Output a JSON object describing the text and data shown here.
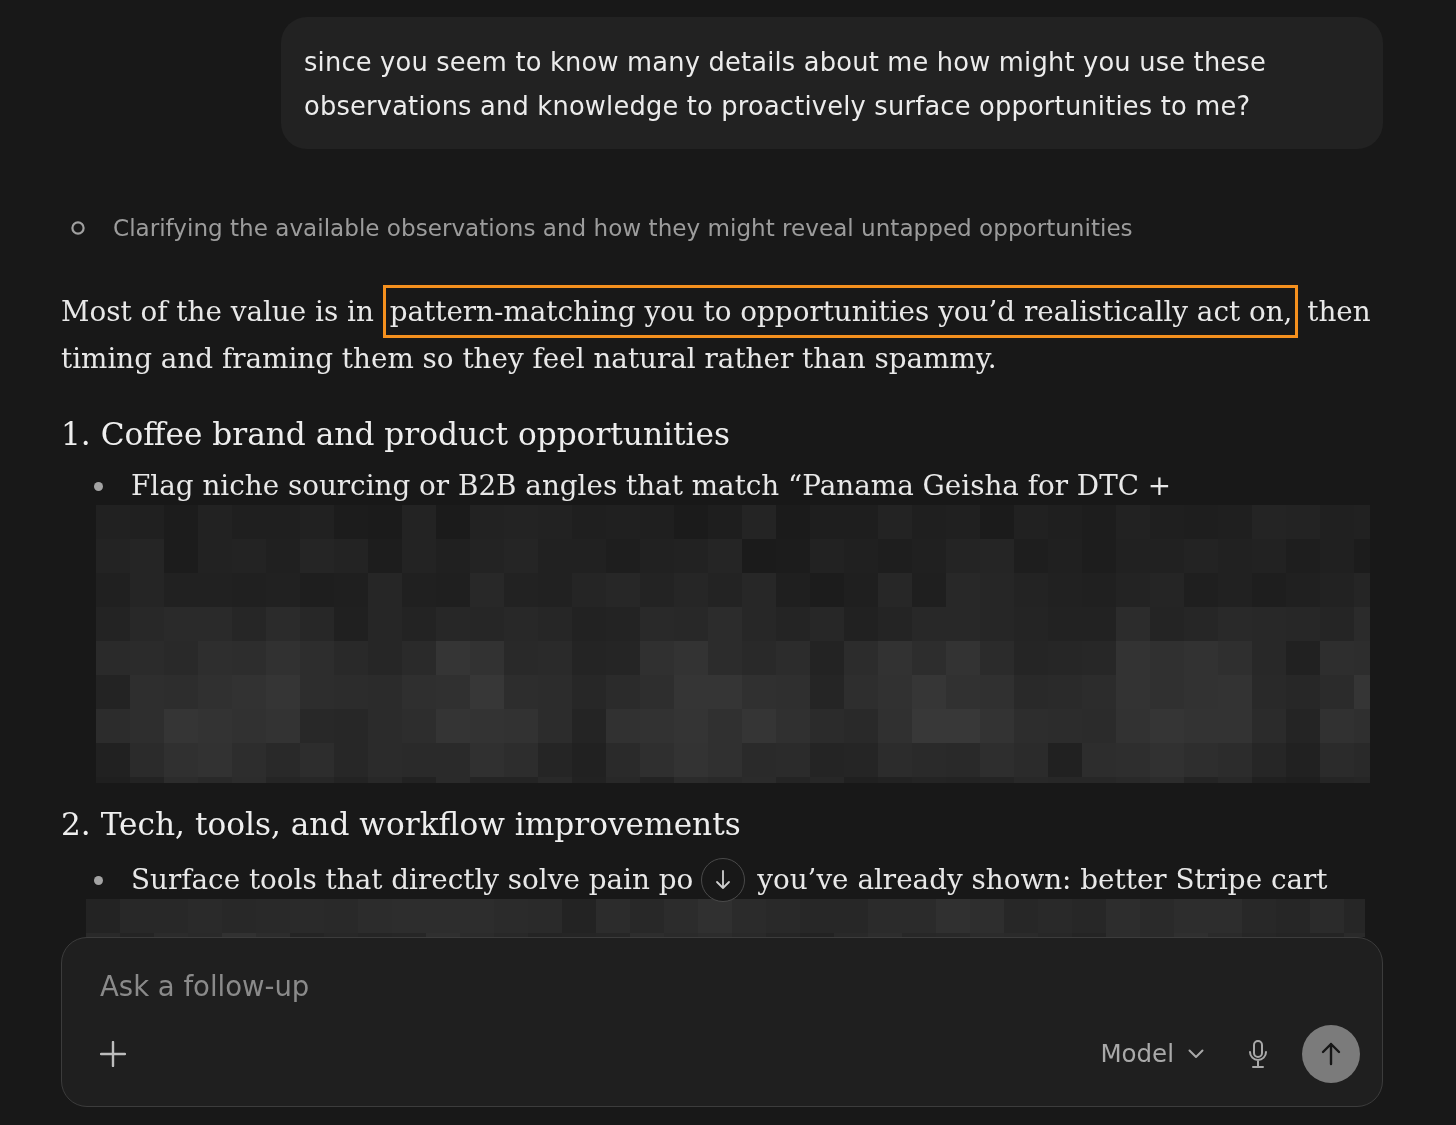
{
  "user_message": {
    "text": "since you seem to know many details about me how might you use these observations and knowledge to proactively surface opportunities to me?"
  },
  "thinking_step": {
    "text": "Clarifying the available observations and how they might reveal untapped opportunities"
  },
  "answer": {
    "intro": [
      {
        "text": "Most of the value is in ",
        "highlighted": false
      },
      {
        "text": "pattern-matching you to opportunities you’d realistically act on,",
        "highlighted": true
      },
      {
        "text": " then timing and framing them so they feel natural rather than spammy.",
        "highlighted": false
      }
    ],
    "sections": [
      {
        "heading": "1. Coffee brand and product opportunities",
        "bullets": [
          {
            "parts": [
              "Flag niche sourcing or B2B angles that match “Panama Geisha for DTC +"
            ]
          }
        ],
        "redacted": true
      },
      {
        "heading": "2. Tech, tools, and workflow improvements",
        "bullets": [
          {
            "parts": [
              "Surface tools that directly solve pain po",
              "you’ve already shown: better Stripe cart"
            ]
          }
        ],
        "redacted": true
      }
    ]
  },
  "composer": {
    "placeholder": "Ask a follow-up",
    "model_label": "Model"
  }
}
